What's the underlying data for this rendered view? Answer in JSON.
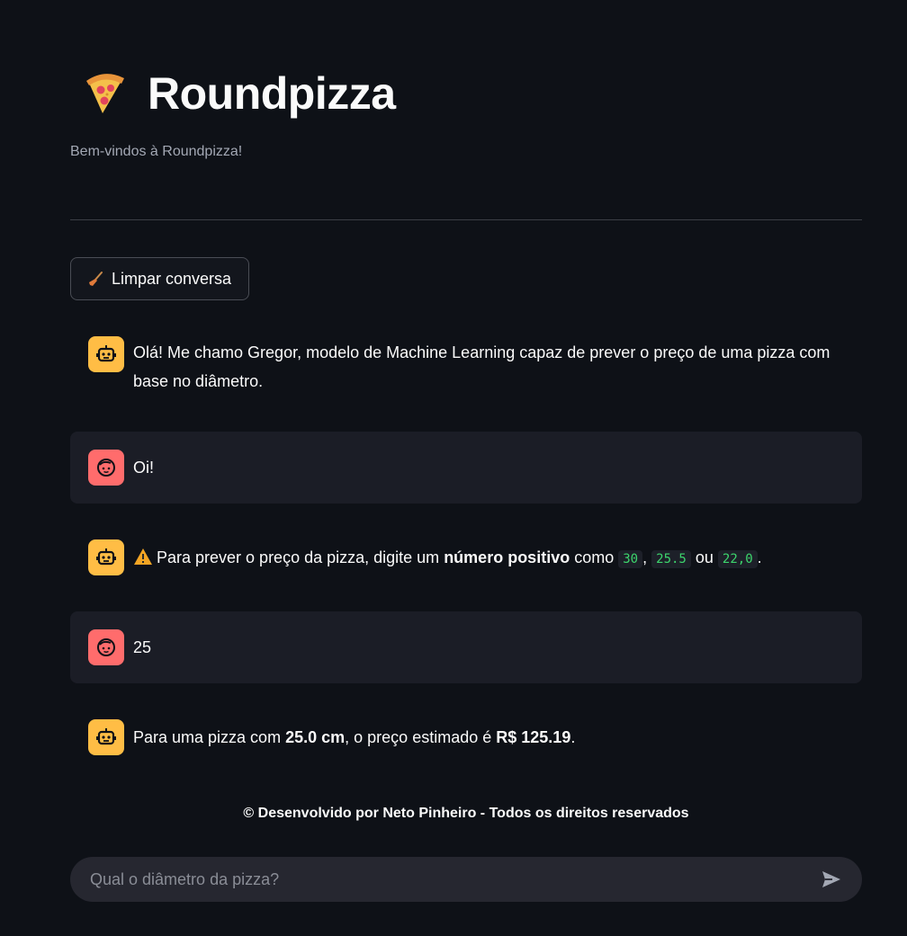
{
  "header": {
    "title": "Roundpizza",
    "subtitle": "Bem-vindos à Roundpizza!",
    "icon": "pizza-slice-icon"
  },
  "toolbar": {
    "clear_label": "Limpar conversa",
    "clear_icon": "broom-icon"
  },
  "messages": [
    {
      "role": "assistant",
      "text": "Olá! Me chamo Gregor, modelo de Machine Learning capaz de prever o preço de uma pizza com base no diâmetro."
    },
    {
      "role": "user",
      "text": "Oi!"
    },
    {
      "role": "assistant",
      "prefix": "Para prever o preço da pizza, digite um",
      "bold": "número positivo",
      "middle": "como",
      "examples": [
        "30",
        "25.5",
        "22,0"
      ],
      "sep": ",",
      "or": "ou",
      "end": "."
    },
    {
      "role": "user",
      "text": "25"
    },
    {
      "role": "assistant",
      "prefix": "Para uma pizza com",
      "size": "25.0 cm",
      "middle": ", o preço estimado é",
      "price": "R$ 125.19",
      "end": "."
    }
  ],
  "footer": {
    "text": "© Desenvolvido por Neto Pinheiro - Todos os direitos reservados"
  },
  "chat_input": {
    "placeholder": "Qual o diâmetro da pizza?",
    "send_icon": "send-icon"
  },
  "colors": {
    "background": "#0e1117",
    "bot_avatar": "#ffbd45",
    "user_avatar": "#ff6c6c",
    "user_bubble": "#1b1d26",
    "code_text": "#3dd56d"
  }
}
